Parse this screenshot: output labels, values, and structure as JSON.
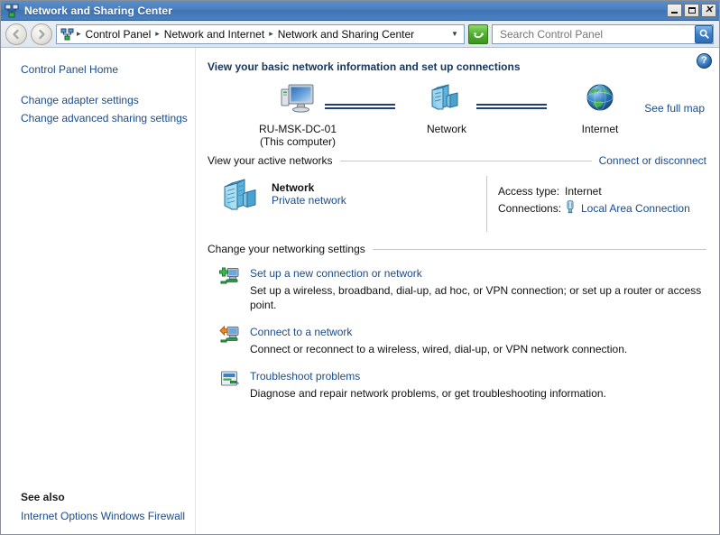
{
  "window": {
    "title": "Network and Sharing Center",
    "icon": "network-icon",
    "controls": {
      "minimize": "Minimize",
      "maximize": "Maximize",
      "close": "Close"
    }
  },
  "toolbar": {
    "back": "Back",
    "forward": "Forward",
    "breadcrumbs": [
      "Control Panel",
      "Network and Internet",
      "Network and Sharing Center"
    ],
    "separator": "▸",
    "dropdown": "▼",
    "refresh": "Refresh",
    "search": {
      "placeholder": "Search Control Panel",
      "value": "",
      "button": "search-icon"
    }
  },
  "sidebar": {
    "links": [
      {
        "label": "Control Panel Home"
      },
      {
        "label": "Change adapter settings"
      },
      {
        "label": "Change advanced sharing settings"
      }
    ],
    "see_also": {
      "title": "See also",
      "links": [
        {
          "label": "Internet Options"
        },
        {
          "label": "Windows Firewall"
        }
      ]
    }
  },
  "content": {
    "help": "?",
    "page_title": "View your basic network information and set up connections",
    "map": {
      "nodes": [
        {
          "label": "RU-MSK-DC-01",
          "sublabel": "(This computer)",
          "icon": "computer-icon"
        },
        {
          "label": "Network",
          "sublabel": "",
          "icon": "network-servers-icon"
        },
        {
          "label": "Internet",
          "sublabel": "",
          "icon": "globe-icon"
        }
      ],
      "see_full_map": "See full map"
    },
    "active_networks": {
      "heading": "View your active networks",
      "action_link": "Connect or disconnect",
      "network": {
        "name": "Network",
        "type": "Private network",
        "icon": "network-servers-icon"
      },
      "details": [
        {
          "key": "Access type:",
          "value": "Internet",
          "link": false
        },
        {
          "key": "Connections:",
          "value": "Local Area Connection",
          "link": true,
          "icon": "lan-plug-icon"
        }
      ]
    },
    "settings": {
      "heading": "Change your networking settings",
      "items": [
        {
          "icon": "new-connection-icon",
          "title": "Set up a new connection or network",
          "desc": "Set up a wireless, broadband, dial-up, ad hoc, or VPN connection; or set up a router or access point."
        },
        {
          "icon": "connect-network-icon",
          "title": "Connect to a network",
          "desc": "Connect or reconnect to a wireless, wired, dial-up, or VPN network connection."
        },
        {
          "icon": "troubleshoot-icon",
          "title": "Troubleshoot problems",
          "desc": "Diagnose and repair network problems, or get troubleshooting information."
        }
      ]
    }
  },
  "colors": {
    "title_bar": "#4a7fbe",
    "link": "#1a4b8c",
    "heading": "#16355e",
    "map_line": "#1f3f79"
  }
}
